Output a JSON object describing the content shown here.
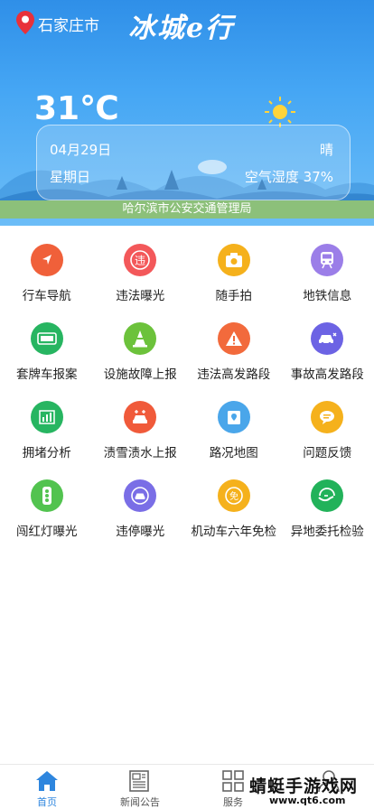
{
  "header": {
    "city": "石家庄市",
    "brand": "冰城e行"
  },
  "weather": {
    "temperature": "31℃",
    "date": "04月29日",
    "condition": "晴",
    "weekday": "星期日",
    "humidity": "空气湿度 37%"
  },
  "agency": "哈尔滨市公安交通管理局",
  "grid": [
    {
      "label": "行车导航",
      "icon": "navigation-arrow-icon",
      "color": "#f0603a"
    },
    {
      "label": "违法曝光",
      "icon": "violation-icon",
      "color": "#f3585a"
    },
    {
      "label": "随手拍",
      "icon": "camera-icon",
      "color": "#f5b11c"
    },
    {
      "label": "地铁信息",
      "icon": "subway-icon",
      "color": "#9b7ee8"
    },
    {
      "label": "套牌车报案",
      "icon": "license-plate-icon",
      "color": "#27b561"
    },
    {
      "label": "设施故障上报",
      "icon": "traffic-cone-icon",
      "color": "#6cc23b"
    },
    {
      "label": "违法高发路段",
      "icon": "warning-icon",
      "color": "#f26a3c"
    },
    {
      "label": "事故高发路段",
      "icon": "car-crash-icon",
      "color": "#6c63e4"
    },
    {
      "label": "拥堵分析",
      "icon": "chart-analysis-icon",
      "color": "#27b561"
    },
    {
      "label": "渍雪渍水上报",
      "icon": "snow-car-icon",
      "color": "#f05a3a"
    },
    {
      "label": "路况地图",
      "icon": "map-icon",
      "color": "#4aa6ea"
    },
    {
      "label": "问题反馈",
      "icon": "feedback-icon",
      "color": "#f5b11c"
    },
    {
      "label": "闯红灯曝光",
      "icon": "traffic-light-icon",
      "color": "#52c34f"
    },
    {
      "label": "违停曝光",
      "icon": "parking-car-icon",
      "color": "#7a6ee6"
    },
    {
      "label": "机动车六年免检",
      "icon": "exempt-badge-icon",
      "color": "#f5b11c"
    },
    {
      "label": "异地委托检验",
      "icon": "handshake-icon",
      "color": "#22b25a"
    }
  ],
  "bottom_nav": [
    {
      "label": "首页",
      "icon": "home-icon",
      "active": true
    },
    {
      "label": "新闻公告",
      "icon": "newspaper-icon",
      "active": false
    },
    {
      "label": "服务",
      "icon": "grid-services-icon",
      "active": false
    },
    {
      "label": "",
      "icon": "user-icon",
      "active": false
    }
  ],
  "watermark": {
    "main": "蜻蜓手游戏网",
    "sub": "www.qt6.com"
  }
}
